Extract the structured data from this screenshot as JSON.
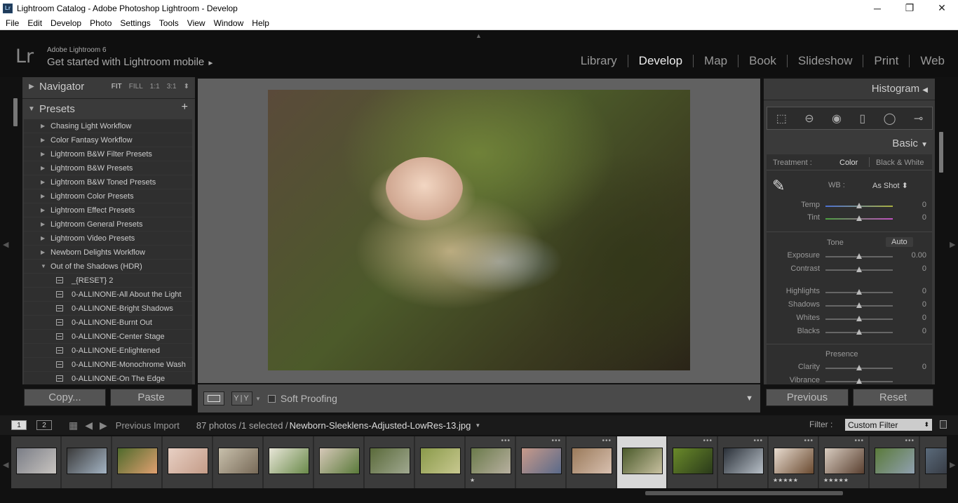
{
  "window": {
    "title": "Lightroom Catalog - Adobe Photoshop Lightroom - Develop",
    "icon_text": "Lr",
    "minimize": "─",
    "restore": "❐",
    "close": "✕"
  },
  "menu": [
    "File",
    "Edit",
    "Develop",
    "Photo",
    "Settings",
    "Tools",
    "View",
    "Window",
    "Help"
  ],
  "identity": {
    "logo": "Lr",
    "product": "Adobe Lightroom 6",
    "mobile": "Get started with Lightroom mobile",
    "mobile_arrow": "►"
  },
  "modules": [
    {
      "label": "Library",
      "active": false
    },
    {
      "label": "Develop",
      "active": true
    },
    {
      "label": "Map",
      "active": false
    },
    {
      "label": "Book",
      "active": false
    },
    {
      "label": "Slideshow",
      "active": false
    },
    {
      "label": "Print",
      "active": false
    },
    {
      "label": "Web",
      "active": false
    }
  ],
  "left": {
    "navigator": {
      "title": "Navigator",
      "opts": [
        "FIT",
        "FILL",
        "1:1",
        "3:1"
      ],
      "selected": "FIT",
      "opts_caret": "⬍"
    },
    "presets": {
      "title": "Presets",
      "add": "+",
      "items": [
        {
          "type": "folder",
          "open": false,
          "label": "Chasing Light Workflow"
        },
        {
          "type": "folder",
          "open": false,
          "label": "Color Fantasy Workflow"
        },
        {
          "type": "folder",
          "open": false,
          "label": "Lightroom B&W Filter Presets"
        },
        {
          "type": "folder",
          "open": false,
          "label": "Lightroom B&W Presets"
        },
        {
          "type": "folder",
          "open": false,
          "label": "Lightroom B&W Toned Presets"
        },
        {
          "type": "folder",
          "open": false,
          "label": "Lightroom Color Presets"
        },
        {
          "type": "folder",
          "open": false,
          "label": "Lightroom Effect Presets"
        },
        {
          "type": "folder",
          "open": false,
          "label": "Lightroom General Presets"
        },
        {
          "type": "folder",
          "open": false,
          "label": "Lightroom Video Presets"
        },
        {
          "type": "folder",
          "open": false,
          "label": "Newborn Delights Workflow"
        },
        {
          "type": "folder",
          "open": true,
          "label": "Out of the Shadows (HDR)"
        },
        {
          "type": "file",
          "label": "_{RESET} 2"
        },
        {
          "type": "file",
          "label": "0-ALLINONE-All About the Light"
        },
        {
          "type": "file",
          "label": "0-ALLINONE-Bright Shadows"
        },
        {
          "type": "file",
          "label": "0-ALLINONE-Burnt Out"
        },
        {
          "type": "file",
          "label": "0-ALLINONE-Center Stage"
        },
        {
          "type": "file",
          "label": "0-ALLINONE-Enlightened"
        },
        {
          "type": "file",
          "label": "0-ALLINONE-Monochrome Wash"
        },
        {
          "type": "file",
          "label": "0-ALLINONE-On The Edge"
        }
      ]
    },
    "copy_label": "Copy...",
    "paste_label": "Paste"
  },
  "toolbar": {
    "yy": "Y|Y",
    "caret": "▼",
    "soft_proofing": "Soft Proofing",
    "menu": "▼"
  },
  "right": {
    "histogram": "Histogram",
    "histogram_arrow": "◀",
    "basic": "Basic",
    "basic_arrow": "▼",
    "treatment_label": "Treatment :",
    "treatment_color": "Color",
    "treatment_bw": "Black & White",
    "wb_label": "WB :",
    "wb_value": "As Shot",
    "wb_caret": "⬍",
    "tone_label": "Tone",
    "auto_label": "Auto",
    "presence_label": "Presence",
    "sliders": [
      {
        "label": "Temp",
        "value": "0",
        "pos": 0.5,
        "kind": "temp"
      },
      {
        "label": "Tint",
        "value": "0",
        "pos": 0.5,
        "kind": "tint"
      },
      {
        "label": "Exposure",
        "value": "0.00",
        "pos": 0.5,
        "kind": "plain"
      },
      {
        "label": "Contrast",
        "value": "0",
        "pos": 0.5,
        "kind": "plain"
      },
      {
        "label": "Highlights",
        "value": "0",
        "pos": 0.5,
        "kind": "plain"
      },
      {
        "label": "Shadows",
        "value": "0",
        "pos": 0.5,
        "kind": "plain"
      },
      {
        "label": "Whites",
        "value": "0",
        "pos": 0.5,
        "kind": "plain"
      },
      {
        "label": "Blacks",
        "value": "0",
        "pos": 0.5,
        "kind": "plain"
      },
      {
        "label": "Clarity",
        "value": "0",
        "pos": 0.5,
        "kind": "plain"
      },
      {
        "label": "Vibrance",
        "value": "",
        "pos": 0.5,
        "kind": "plain"
      }
    ],
    "previous_label": "Previous",
    "reset_label": "Reset"
  },
  "filmbar": {
    "page1": "1",
    "page2": "2",
    "grid": "▦",
    "back": "◀",
    "forward": "▶",
    "source": "Previous Import",
    "count": "87 photos /1 selected /",
    "path": "Newborn-Sleeklens-Adjusted-LowRes-13.jpg",
    "path_caret": "▼",
    "filter_label": "Filter :",
    "filter_value": "Custom Filter",
    "filter_caret": "⬍"
  },
  "edges": {
    "left": "◀",
    "right": "▶",
    "top": "▲"
  },
  "filmstrip": [
    {
      "colors": [
        "#7a7d86",
        "#c8c4c0"
      ],
      "dots": false,
      "stars": ""
    },
    {
      "colors": [
        "#3a3a3a",
        "#a4b4c4"
      ],
      "dots": false,
      "stars": ""
    },
    {
      "colors": [
        "#4f6a2c",
        "#e0a070"
      ],
      "dots": false,
      "stars": ""
    },
    {
      "colors": [
        "#e8d0c4",
        "#c49c88"
      ],
      "dots": false,
      "stars": ""
    },
    {
      "colors": [
        "#c8c0ac",
        "#786a58"
      ],
      "dots": false,
      "stars": ""
    },
    {
      "colors": [
        "#e8e6d8",
        "#6a8a4a"
      ],
      "dots": false,
      "stars": ""
    },
    {
      "colors": [
        "#d6c8b8",
        "#5a7a3a"
      ],
      "dots": false,
      "stars": ""
    },
    {
      "colors": [
        "#5a6a3a",
        "#a0a890"
      ],
      "dots": false,
      "stars": ""
    },
    {
      "colors": [
        "#8a9a4a",
        "#c8c890"
      ],
      "dots": false,
      "stars": ""
    },
    {
      "colors": [
        "#6a7a4a",
        "#b8b0a0"
      ],
      "dots": true,
      "stars": "★"
    },
    {
      "colors": [
        "#c89a8a",
        "#5a6a8a"
      ],
      "dots": true,
      "stars": ""
    },
    {
      "colors": [
        "#9a7a5a",
        "#d8c0b0"
      ],
      "dots": true,
      "stars": ""
    },
    {
      "colors": [
        "#4a5a2a",
        "#c8c0a0"
      ],
      "dots": false,
      "stars": ""
    },
    {
      "colors": [
        "#6a8a2a",
        "#2a3a1a"
      ],
      "dots": true,
      "stars": ""
    },
    {
      "colors": [
        "#2a3038",
        "#b8c0c8"
      ],
      "dots": true,
      "stars": ""
    },
    {
      "colors": [
        "#e8dcd0",
        "#6a4a30"
      ],
      "dots": true,
      "stars": "★★★★★"
    },
    {
      "colors": [
        "#d8ccc0",
        "#5a4030"
      ],
      "dots": true,
      "stars": "★★★★★"
    },
    {
      "colors": [
        "#5a7a3a",
        "#90a0b0"
      ],
      "dots": true,
      "stars": ""
    },
    {
      "colors": [
        "#5a6a7a",
        "#2a2a30"
      ],
      "dots": false,
      "stars": ""
    }
  ]
}
